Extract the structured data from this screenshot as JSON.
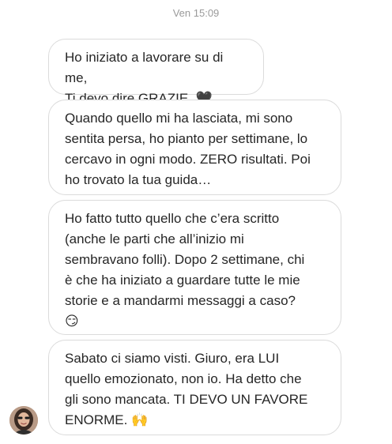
{
  "chat": {
    "timestamp": "Ven 15:09",
    "messages": [
      {
        "text": "Ho iniziato a lavorare su di me,\nTi devo dire GRAZIE. 🖤"
      },
      {
        "text": "Quando quello mi ha lasciata, mi sono\nsentita persa, ho pianto per settimane, lo\ncercavo in ogni modo. ZERO risultati. Poi\nho trovato la tua guida…"
      },
      {
        "text": "Ho fatto tutto quello che c’era scritto\n(anche le parti che all’inizio mi\nsembravano folli). Dopo 2 settimane, chi\nè che ha iniziato a guardare tutte le mie\nstorie e a mandarmi messaggi a caso?\n😏"
      },
      {
        "text": "Sabato ci siamo visti. Giuro, era LUI\nquello emozionato, non io. Ha detto che\ngli sono mancata. TI DEVO UN FAVORE\nENORME. 🙌"
      }
    ],
    "sender_avatar": "profile-photo"
  }
}
